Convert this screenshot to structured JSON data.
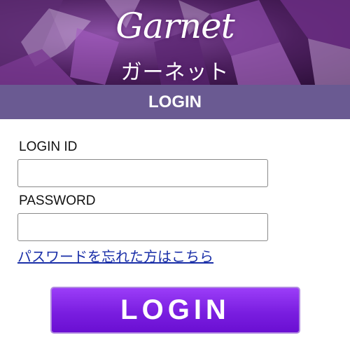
{
  "header": {
    "logo_script": "Garnet",
    "logo_kana": "ガーネット",
    "title": "LOGIN"
  },
  "form": {
    "login_id_label": "LOGIN ID",
    "login_id_value": "",
    "password_label": "PASSWORD",
    "password_value": "",
    "forgot_link": "パスワードを忘れた方はこちら",
    "submit_label": "LOGIN"
  },
  "colors": {
    "title_bar": "#6a5a92",
    "button": "#7a1ee0",
    "link": "#1a2fa8"
  }
}
